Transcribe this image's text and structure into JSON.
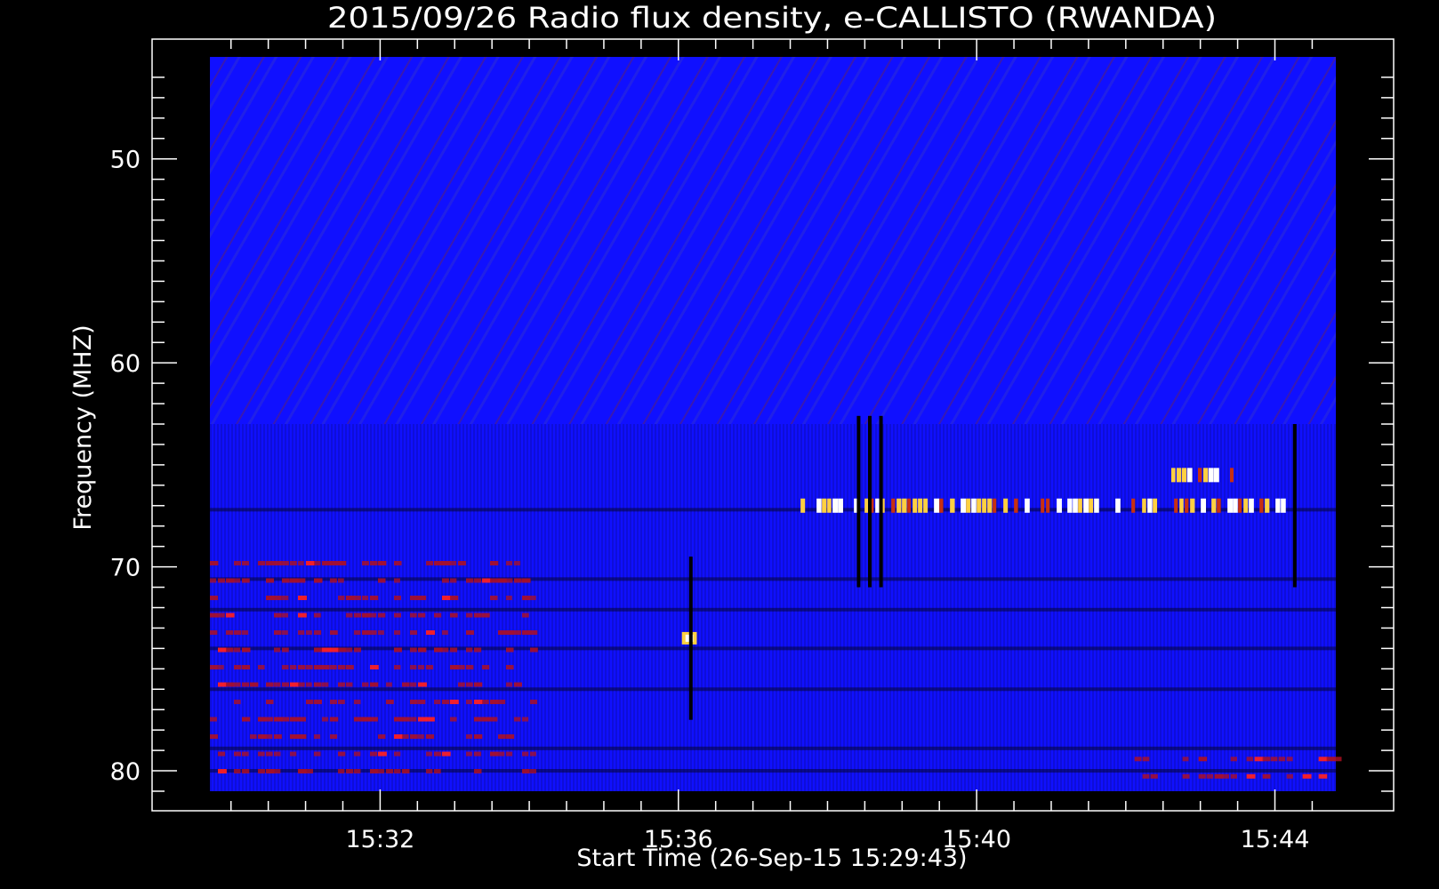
{
  "chart_data": {
    "type": "heatmap",
    "title": "2015/09/26  Radio flux density, e-CALLISTO (RWANDA)",
    "xlabel": "Start Time (26-Sep-15 15:29:43)",
    "ylabel": "Frequency (MHZ)",
    "x_tick_labels": [
      "15:32",
      "15:36",
      "15:40",
      "15:44"
    ],
    "x_ticks_minutes": [
      2.283,
      6.283,
      10.283,
      14.283
    ],
    "xlim_minutes": [
      0,
      15.1
    ],
    "y_tick_labels": [
      "50",
      "60",
      "70",
      "80"
    ],
    "y_ticks": [
      50,
      60,
      70,
      80
    ],
    "ylim": [
      45,
      81
    ],
    "y_inverted": true,
    "colors": {
      "background": "#000000",
      "low": "#1010ff",
      "medium": "#b01020",
      "high": "#ffd040",
      "peak": "#ffffff"
    },
    "features": [
      {
        "kind": "band",
        "freq_mhz": 67.0,
        "t_start_min": 7.85,
        "t_end_min": 14.45,
        "intensity": "high"
      },
      {
        "kind": "band",
        "freq_mhz": 65.5,
        "t_start_min": 12.75,
        "t_end_min": 13.75,
        "intensity": "high"
      },
      {
        "kind": "burst",
        "freq_mhz": 73.5,
        "t_start_min": 6.33,
        "t_end_min": 6.53,
        "intensity": "high"
      },
      {
        "kind": "stripe",
        "t_min": 8.7,
        "f_start_mhz": 62.6,
        "f_end_mhz": 71.0
      },
      {
        "kind": "stripe",
        "t_min": 8.85,
        "f_start_mhz": 62.6,
        "f_end_mhz": 71.0
      },
      {
        "kind": "stripe",
        "t_min": 9.0,
        "f_start_mhz": 62.6,
        "f_end_mhz": 71.0
      },
      {
        "kind": "stripe",
        "t_min": 6.45,
        "f_start_mhz": 69.5,
        "f_end_mhz": 77.5
      },
      {
        "kind": "stripe",
        "t_min": 14.55,
        "f_start_mhz": 63.0,
        "f_end_mhz": 71.0
      },
      {
        "kind": "region",
        "t_start_min": 0,
        "t_end_min": 4.3,
        "f_start_mhz": 69.8,
        "f_end_mhz": 80.5,
        "intensity": "medium"
      },
      {
        "kind": "region",
        "t_start_min": 12.4,
        "t_end_min": 15.1,
        "f_start_mhz": 79.4,
        "f_end_mhz": 81.0,
        "intensity": "medium"
      }
    ]
  }
}
